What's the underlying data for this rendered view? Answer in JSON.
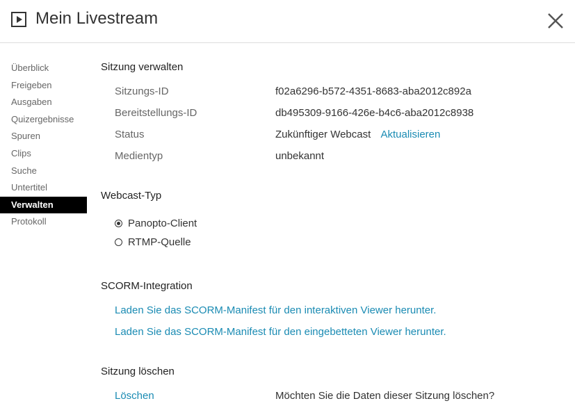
{
  "header": {
    "title": "Mein Livestream",
    "play_icon": "play-box-icon",
    "close_icon": "close-icon"
  },
  "nav": {
    "items": [
      {
        "label": "Überblick"
      },
      {
        "label": "Freigeben"
      },
      {
        "label": "Ausgaben"
      },
      {
        "label": "Quizergebnisse"
      },
      {
        "label": "Spuren"
      },
      {
        "label": "Clips"
      },
      {
        "label": "Suche"
      },
      {
        "label": "Untertitel"
      },
      {
        "label": "Verwalten",
        "active": true
      },
      {
        "label": "Protokoll"
      }
    ]
  },
  "manage": {
    "title": "Sitzung verwalten",
    "session_id_label": "Sitzungs-ID",
    "session_id_value": "f02a6296-b572-4351-8683-aba2012c892a",
    "deployment_id_label": "Bereitstellungs-ID",
    "deployment_id_value": "db495309-9166-426e-b4c6-aba2012c8938",
    "status_label": "Status",
    "status_value": "Zukünftiger Webcast",
    "refresh_link": "Aktualisieren",
    "media_type_label": "Medientyp",
    "media_type_value": "unbekannt"
  },
  "webcast": {
    "title": "Webcast-Typ",
    "options": [
      {
        "label": "Panopto-Client",
        "selected": true
      },
      {
        "label": "RTMP-Quelle",
        "selected": false
      }
    ]
  },
  "scorm": {
    "title": "SCORM-Integration",
    "link_interactive": "Laden Sie das SCORM-Manifest für den interaktiven Viewer herunter.",
    "link_embedded": "Laden Sie das SCORM-Manifest für den eingebetteten Viewer herunter."
  },
  "delete": {
    "title": "Sitzung löschen",
    "delete_link": "Löschen",
    "prompt": "Möchten Sie die Daten dieser Sitzung löschen?"
  },
  "colors": {
    "link": "#1a8bb3",
    "active_nav_bg": "#000000",
    "active_nav_text": "#ffffff"
  }
}
